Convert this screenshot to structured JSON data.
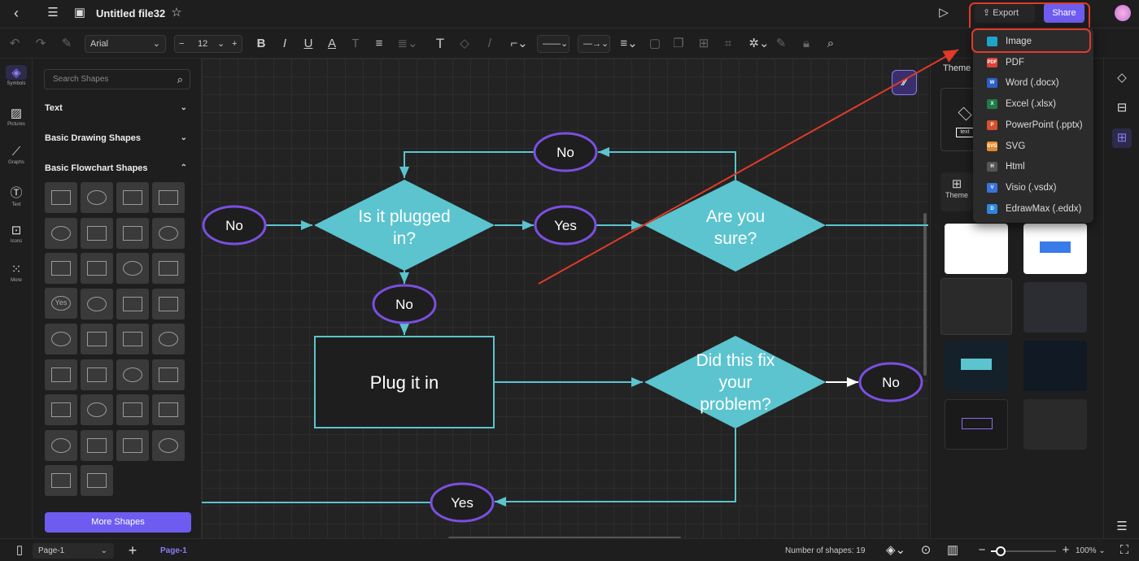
{
  "header": {
    "title": "Untitled file32",
    "export_label": "Export",
    "share_label": "Share"
  },
  "toolbar": {
    "font": "Arial",
    "font_size": "12"
  },
  "leftbar": [
    {
      "label": "Symbols",
      "icon": "symbols-icon"
    },
    {
      "label": "Pictures",
      "icon": "pictures-icon"
    },
    {
      "label": "Graphs",
      "icon": "graphs-icon"
    },
    {
      "label": "Text",
      "icon": "text-icon"
    },
    {
      "label": "Icons",
      "icon": "icons-icon"
    },
    {
      "label": "More",
      "icon": "more-icon"
    }
  ],
  "shapes_panel": {
    "search_placeholder": "Search Shapes",
    "categories": [
      "Text",
      "Basic Drawing Shapes",
      "Basic Flowchart Shapes"
    ],
    "more_shapes": "More Shapes",
    "yes_shape": "Yes"
  },
  "export_menu": [
    {
      "label": "Image",
      "badge": "",
      "color": "#1fa3c9"
    },
    {
      "label": "PDF",
      "badge": "PDF",
      "color": "#d9433a"
    },
    {
      "label": "Word (.docx)",
      "badge": "W",
      "color": "#2b5fc9"
    },
    {
      "label": "Excel (.xlsx)",
      "badge": "X",
      "color": "#1e7d45"
    },
    {
      "label": "PowerPoint (.pptx)",
      "badge": "P",
      "color": "#d4512e"
    },
    {
      "label": "SVG",
      "badge": "SVG",
      "color": "#e0892a"
    },
    {
      "label": "Html",
      "badge": "H",
      "color": "#555555"
    },
    {
      "label": "Visio (.vsdx)",
      "badge": "V",
      "color": "#3b72d9"
    },
    {
      "label": "EdrawMax (.eddx)",
      "badge": "D",
      "color": "#2f86e0"
    }
  ],
  "right_panel": {
    "tab": "Theme",
    "theme_button": "Theme",
    "preview_text": "text"
  },
  "diagram": {
    "no1": "No",
    "q1": [
      "Is it plugged",
      "in?"
    ],
    "yes1": "Yes",
    "q2": [
      "Are you",
      "sure?"
    ],
    "no_top": "No",
    "no2": "No",
    "rect": "Plug it in",
    "q3": [
      "Did this fix",
      "your",
      "problem?"
    ],
    "no3": "No",
    "yes2": "Yes"
  },
  "bottom": {
    "page_select": "Page-1",
    "page_tab": "Page-1",
    "shape_count": "Number of shapes: 19",
    "zoom": "100%",
    "zoom_level": 0.15
  },
  "colors": {
    "accent": "#6e5cf0",
    "shape_fill": "#5bc4cf",
    "ellipse_stroke": "#7b4fe0",
    "annotation": "#e03a2a"
  }
}
